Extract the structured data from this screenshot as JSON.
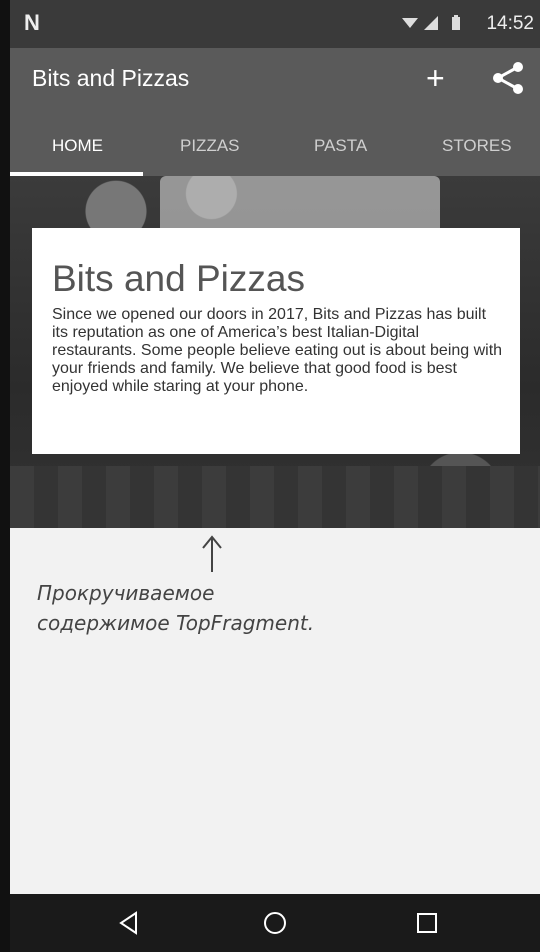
{
  "status_bar": {
    "notification_icon": "N",
    "time": "14:52"
  },
  "app_bar": {
    "title": "Bits and Pizzas",
    "add_icon": "plus-icon",
    "share_icon": "share-icon"
  },
  "tabs": [
    {
      "label": "HOME",
      "active": true
    },
    {
      "label": "PIZZAS",
      "active": false
    },
    {
      "label": "PASTA",
      "active": false
    },
    {
      "label": "STORES",
      "active": false
    }
  ],
  "card": {
    "heading": "Bits and Pizzas",
    "body": "Since we opened our doors in 2017, Bits and Pizzas has built its reputation as one of America’s best Italian-Digital restaurants. Some people believe eating out is about being with your friends and family. We believe that good food is best enjoyed while staring at your phone."
  },
  "annotation": {
    "line1": "Прокручиваемое",
    "line2": "содержимое TopFragment."
  },
  "nav_bar": {
    "back_icon": "back-icon",
    "home_icon": "home-icon",
    "recents_icon": "recents-icon"
  }
}
